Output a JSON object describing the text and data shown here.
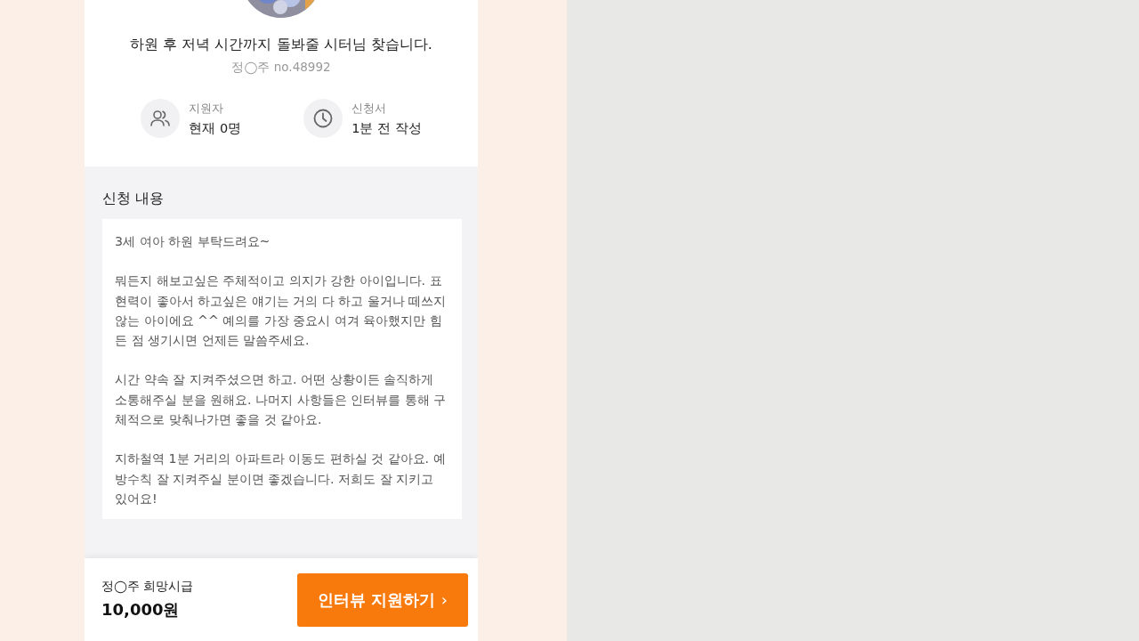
{
  "header": {
    "title": "하원 후 저녁 시간까지 돌봐줄 시터님 찾습니다.",
    "author": "정◯주 no.48992"
  },
  "stats": [
    {
      "kind": "people",
      "label": "지원자",
      "value": "현재 0명"
    },
    {
      "kind": "clock",
      "label": "신청서",
      "value": "1분 전 작성"
    }
  ],
  "request": {
    "heading": "신청 내용",
    "paragraphs": [
      "3세 여아 하원 부탁드려요~",
      "뭐든지 해보고싶은 주체적이고 의지가 강한 아이입니다. 표현력이 좋아서 하고싶은 얘기는 거의 다 하고 울거나 떼쓰지 않는 아이에요 ^^ 예의를 가장 중요시 여겨 육아했지만 힘든 점 생기시면 언제든 말씀주세요.",
      "시간 약속 잘 지켜주셨으면 하고. 어떤 상황이든 솔직하게 소통해주실 분을 원해요. 나머지 사항들은 인터뷰를 통해 구체적으로 맞춰나가면 좋을 것 같아요.",
      "지하철역 1분 거리의 아파트라 이동도 편하실 것 같아요. 예방수칙 잘 지켜주실 분이면 좋겠습니다.  저희도 잘 지키고 있어요!"
    ]
  },
  "bottom_bar": {
    "wage_label": "정◯주 희망시급",
    "wage": "10,000원",
    "button": "인터뷰 지원하기",
    "button_icon": "›"
  }
}
